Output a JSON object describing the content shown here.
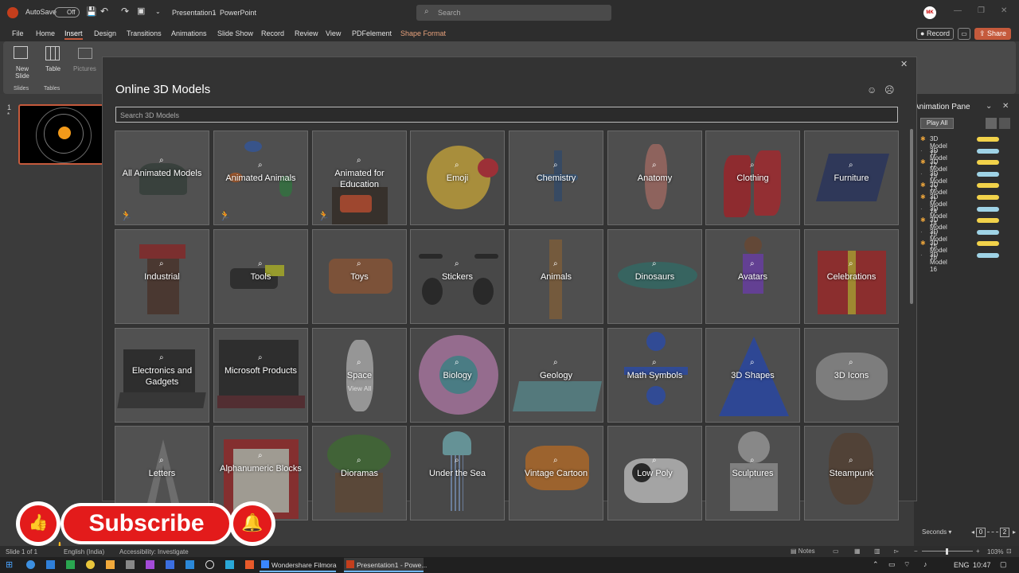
{
  "titlebar": {
    "autosave_label": "AutoSave",
    "autosave_state": "Off",
    "doc_title": "Presentation1",
    "separator": "-",
    "app_name": "PowerPoint",
    "search_placeholder": "Search",
    "avatar_initials": "MK"
  },
  "tabs": [
    "File",
    "Home",
    "Insert",
    "Design",
    "Transitions",
    "Animations",
    "Slide Show",
    "Record",
    "Review",
    "View",
    "PDFelement",
    "Shape Format"
  ],
  "active_tab": "Insert",
  "record_btn": "Record",
  "share_btn": "Share",
  "ribbon": {
    "new_slide": "New Slide",
    "table": "Table",
    "pictures": "Pictures",
    "group_slides": "Slides",
    "group_tables": "Tables"
  },
  "slide_number": "1",
  "dialog": {
    "title": "Online 3D Models",
    "search_placeholder": "Search 3D Models",
    "close": "✕",
    "tiles": [
      {
        "label": "All Animated Models",
        "animated": true
      },
      {
        "label": "Animated Animals",
        "animated": true
      },
      {
        "label": "Animated for Education",
        "animated": true
      },
      {
        "label": "Emoji"
      },
      {
        "label": "Chemistry"
      },
      {
        "label": "Anatomy"
      },
      {
        "label": "Clothing"
      },
      {
        "label": "Furniture"
      },
      {
        "label": "Industrial"
      },
      {
        "label": "Tools"
      },
      {
        "label": "Toys"
      },
      {
        "label": "Stickers"
      },
      {
        "label": "Animals"
      },
      {
        "label": "Dinosaurs"
      },
      {
        "label": "Avatars"
      },
      {
        "label": "Celebrations"
      },
      {
        "label": "Electronics and Gadgets"
      },
      {
        "label": "Microsoft Products"
      },
      {
        "label": "Space",
        "sub": "View All"
      },
      {
        "label": "Biology"
      },
      {
        "label": "Geology"
      },
      {
        "label": "Math Symbols"
      },
      {
        "label": "3D Shapes"
      },
      {
        "label": "3D Icons"
      },
      {
        "label": "Letters"
      },
      {
        "label": "Alphanumeric Blocks"
      },
      {
        "label": "Dioramas"
      },
      {
        "label": "Under the Sea"
      },
      {
        "label": "Vintage Cartoon"
      },
      {
        "label": "Low Poly"
      },
      {
        "label": "Sculptures"
      },
      {
        "label": "Steampunk"
      }
    ]
  },
  "animation_pane": {
    "title": "Animation Pane",
    "play_all": "Play All",
    "items": [
      {
        "name": "3D Model 12",
        "color": "#f2d24a"
      },
      {
        "name": "3D Model 12",
        "color": "#9fd3e6"
      },
      {
        "name": "3D Model 13",
        "color": "#f2d24a"
      },
      {
        "name": "3D Model 13",
        "color": "#9fd3e6"
      },
      {
        "name": "3D Model 11",
        "color": "#f2d24a"
      },
      {
        "name": "3D Model 14",
        "color": "#f2d24a"
      },
      {
        "name": "3D Model 14",
        "color": "#9fd3e6"
      },
      {
        "name": "3D Model 15",
        "color": "#f2d24a"
      },
      {
        "name": "3D Model 15",
        "color": "#9fd3e6"
      },
      {
        "name": "3D Model 16",
        "color": "#f2d24a"
      },
      {
        "name": "3D Model 16",
        "color": "#9fd3e6"
      }
    ],
    "seconds_label": "Seconds",
    "timeline_start": "0",
    "timeline_end": "2"
  },
  "statusbar": {
    "slide_info": "Slide 1 of 1",
    "language": "English (India)",
    "accessibility": "Accessibility: Investigate",
    "notes": "Notes",
    "zoom": "103%"
  },
  "taskbar": {
    "filmora": "Wondershare Filmora",
    "powerpoint": "Presentation1 - Powe...",
    "lang": "ENG",
    "time": "10:47"
  },
  "subscribe": {
    "label": "Subscribe"
  },
  "colors": {
    "accent": "#c55a3c",
    "dialog_bg": "#333333",
    "tile_bg": "#4e4e4e"
  }
}
